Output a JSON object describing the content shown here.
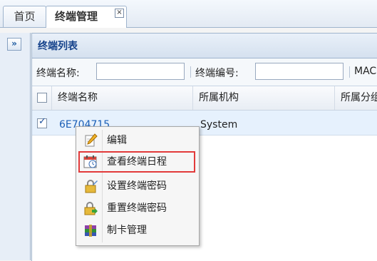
{
  "tabs": [
    {
      "label": "首页"
    },
    {
      "label": "终端管理",
      "close": "×"
    }
  ],
  "sidebar": {
    "expand_glyph": "»"
  },
  "panel": {
    "title": "终端列表"
  },
  "filters": {
    "name_label": "终端名称:",
    "name_value": "",
    "number_label": "终端编号:",
    "number_value": "",
    "mac_label": "MAC"
  },
  "grid": {
    "columns": [
      "终端名称",
      "所属机构",
      "所属分组"
    ],
    "rows": [
      {
        "checked": true,
        "name": "6E704715",
        "org": "System"
      }
    ]
  },
  "context_menu": {
    "items": [
      {
        "label": "编辑",
        "icon": "edit-pencil-icon"
      },
      {
        "label": "查看终端日程",
        "icon": "calendar-clock-icon",
        "highlighted": true
      },
      {
        "label": "设置终端密码",
        "icon": "lock-settings-icon"
      },
      {
        "label": "重置终端密码",
        "icon": "lock-reset-icon"
      },
      {
        "label": "制卡管理",
        "icon": "card-stack-icon"
      }
    ]
  },
  "colors": {
    "accent": "#15428b",
    "highlight_border": "#e23a3a",
    "link": "#1b5fb6"
  }
}
